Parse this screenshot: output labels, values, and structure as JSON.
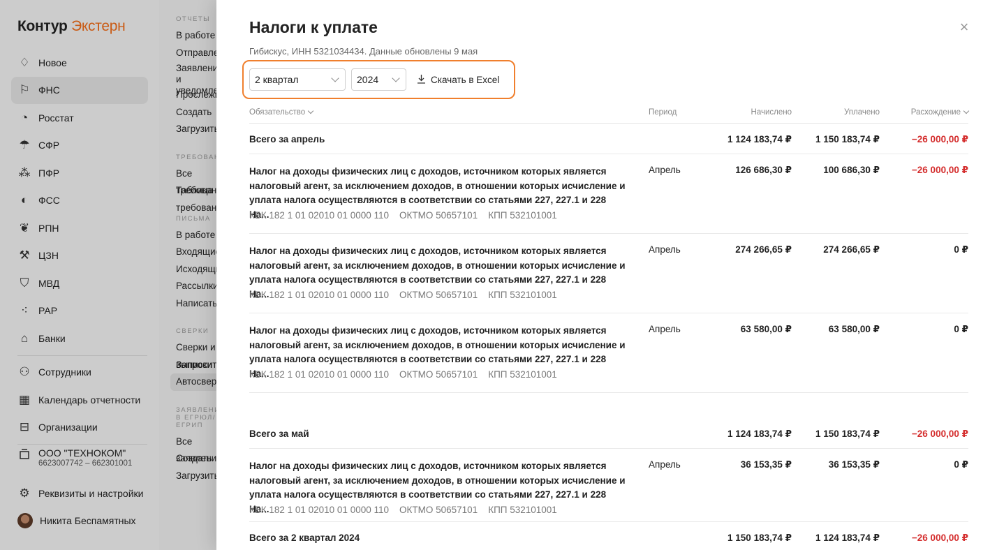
{
  "brand": {
    "main": "Контур",
    "accent": "Экстерн",
    "accent_color": "#f06d1a"
  },
  "sidebar": {
    "items": [
      {
        "label": "Новое",
        "icon": "bell-icon"
      },
      {
        "label": "ФНС",
        "icon": "flag-icon",
        "active": true
      },
      {
        "label": "Росстат",
        "icon": "pie-chart-icon"
      },
      {
        "label": "СФР",
        "icon": "umbrella-icon"
      },
      {
        "label": "ПФР",
        "icon": "people-group-icon"
      },
      {
        "label": "ФСС",
        "icon": "shield-half-icon"
      },
      {
        "label": "РПН",
        "icon": "leaf-icon"
      },
      {
        "label": "ЦЗН",
        "icon": "tools-icon"
      },
      {
        "label": "МВД",
        "icon": "shield-icon"
      },
      {
        "label": "РАР",
        "icon": "grapes-icon"
      },
      {
        "label": "Банки",
        "icon": "bank-icon"
      }
    ],
    "bottom_items": [
      {
        "label": "Сотрудники",
        "icon": "users-icon"
      },
      {
        "label": "Календарь отчетности",
        "icon": "calendar-icon"
      },
      {
        "label": "Организации",
        "icon": "briefcase-icon"
      }
    ],
    "org": {
      "name": "ООО \"ТЕХНОКОМ\"",
      "sub": "6623007742 – 662301001",
      "icon": "org-icon"
    },
    "settings": {
      "label": "Реквизиты и настройки",
      "icon": "gear-icon"
    },
    "user": {
      "label": "Никита Беспамятных",
      "icon": "avatar"
    }
  },
  "subnav": {
    "sections": [
      {
        "title": "ОТЧЕТЫ",
        "items": [
          "В работе",
          "Отправленные",
          "Заявления\nи уведомления",
          "Прослеживаемость",
          "Создать",
          "Загрузить"
        ]
      },
      {
        "title": "ТРЕБОВАНИЯ",
        "items": [
          "Все требования",
          "Таблица требований"
        ]
      },
      {
        "title": "ПИСЬМА",
        "items": [
          "В работе",
          "Входящие",
          "Исходящие",
          "Рассылки",
          "Написать"
        ]
      },
      {
        "title": "СВЕРКИ",
        "items": [
          "Сверки и выписки",
          "Запросить",
          "Автосверка"
        ]
      },
      {
        "title": "ЗАЯВЛЕНИЯ\nВ ЕГРЮЛ/ЕГРИП",
        "items": [
          "Все заявления",
          "Создать",
          "Загрузить"
        ]
      }
    ]
  },
  "panel": {
    "title": "Налоги к уплате",
    "subtitle": "Гибискус, ИНН 5321034434. Данные обновлены 9 мая",
    "close_icon": "close-icon",
    "filters": {
      "quarter": "2 квартал",
      "year": "2024",
      "download_label": "Скачать в Excel",
      "highlight_color": "#f07f2d"
    },
    "columns": {
      "obligation": "Обязательство",
      "period": "Период",
      "accrued": "Начислено",
      "paid": "Уплачено",
      "diff": "Расхождение"
    },
    "rows": [
      {
        "type": "total",
        "label": "Всего за апрель",
        "accrued": "1 124 183,74 ₽",
        "paid": "1 150 183,74 ₽",
        "diff": "−26 000,00 ₽",
        "neg": true
      },
      {
        "type": "item",
        "desc": "Налог на доходы физических лиц с доходов, источником которых является налоговый агент, за исключением доходов, в отношении которых исчисление и уплата налога осуществляются в соответствии со статьями 227, 227.1 и 228 На...",
        "kbk": "КБК 182 1 01 02010 01 0000 110",
        "oktmo": "ОКТМО 50657101",
        "kpp": "КПП 532101001",
        "period": "Апрель",
        "accrued": "126 686,30 ₽",
        "paid": "100 686,30 ₽",
        "diff": "−26 000,00 ₽",
        "neg": true
      },
      {
        "type": "item",
        "desc": "Налог на доходы физических лиц с доходов, источником которых является налоговый агент, за исключением доходов, в отношении которых исчисление и уплата налога осуществляются в соответствии со статьями 227, 227.1 и 228 На...",
        "kbk": "КБК 182 1 01 02010 01 0000 110",
        "oktmo": "ОКТМО 50657101",
        "kpp": "КПП 532101001",
        "period": "Апрель",
        "accrued": "274 266,65 ₽",
        "paid": "274 266,65 ₽",
        "diff": "0 ₽",
        "neg": false
      },
      {
        "type": "item",
        "desc": "Налог на доходы физических лиц с доходов, источником которых является налоговый агент, за исключением доходов, в отношении которых исчисление и уплата налога осуществляются в соответствии со статьями 227, 227.1 и 228 На...",
        "kbk": "КБК 182 1 01 02010 01 0000 110",
        "oktmo": "ОКТМО 50657101",
        "kpp": "КПП 532101001",
        "period": "Апрель",
        "accrued": "63 580,00 ₽",
        "paid": "63 580,00 ₽",
        "diff": "0 ₽",
        "neg": false
      },
      {
        "type": "total",
        "label": "Всего за май",
        "accrued": "1 124 183,74 ₽",
        "paid": "1 150 183,74 ₽",
        "diff": "−26 000,00 ₽",
        "neg": true
      },
      {
        "type": "item",
        "desc": "Налог на доходы физических лиц с доходов, источником которых является налоговый агент, за исключением доходов, в отношении которых исчисление и уплата налога осуществляются в соответствии со статьями 227, 227.1 и 228 На...",
        "kbk": "КБК 182 1 01 02010 01 0000 110",
        "oktmo": "ОКТМО 50657101",
        "kpp": "КПП 532101001",
        "period": "Апрель",
        "accrued": "36 153,35 ₽",
        "paid": "36 153,35 ₽",
        "diff": "0 ₽",
        "neg": false
      },
      {
        "type": "total",
        "label": "Всего за 2 квартал 2024",
        "accrued": "1 150 183,74 ₽",
        "paid": "1 124 183,74 ₽",
        "diff": "−26 000,00 ₽",
        "neg": true
      }
    ]
  }
}
